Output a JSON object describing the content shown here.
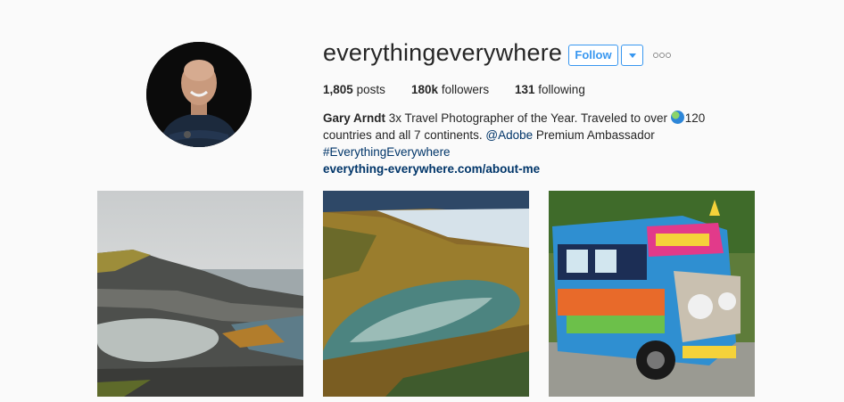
{
  "profile": {
    "username": "everythingeverywhere",
    "follow_label": "Follow",
    "dropdown_icon": "chevron-down-icon",
    "more_icon": "ellipsis-icon",
    "stats": {
      "posts_count": "1,805",
      "posts_label": "posts",
      "followers_count": "180k",
      "followers_label": "followers",
      "following_count": "131",
      "following_label": "following"
    },
    "bio": {
      "name": "Gary Arndt",
      "text_1": "3x Travel Photographer of the Year. Traveled to over",
      "globe_icon": "globe-emoji-icon",
      "text_2": "120 countries and all 7 continents.",
      "mention": "@Adobe",
      "text_3": "Premium Ambassador",
      "hashtag": "#EverythingEverywhere",
      "website": "everything-everywhere.com/about-me"
    }
  },
  "posts": [
    {
      "subject": "coastal-rock-pool-photo"
    },
    {
      "subject": "mountain-lake-aerial-photo"
    },
    {
      "subject": "painted-jeepney-photo"
    }
  ],
  "colors": {
    "accent": "#3897f0",
    "link": "#003569",
    "background": "#fafafa",
    "text": "#262626"
  }
}
